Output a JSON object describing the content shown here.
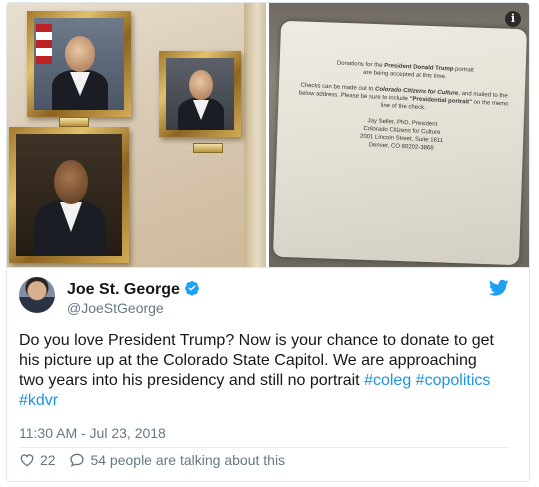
{
  "media": {
    "sign": {
      "para1_a": "Donations for the ",
      "para1_b": "President Donald Trump",
      "para1_c": " portrait",
      "para1_d": "are being accepted at this time.",
      "para2_a": "Checks can be made out to ",
      "para2_b": "Colorado Citizens for Culture",
      "para2_c": ", and mailed to the below address. Please be sure to include ",
      "para2_d": "\"Presidential portrait\"",
      "para2_e": " on the memo line of the check.",
      "addr1": "Jay Seller, PhD, President",
      "addr2": "Colorado Citizens for Culture",
      "addr3": "2001 Lincoln Street, Suite 1611",
      "addr4": "Denver, CO 80202-3868"
    },
    "info_icon_glyph": "i"
  },
  "author": {
    "name": "Joe St. George",
    "handle": "@JoeStGeorge",
    "verified_color": "#1da1f2"
  },
  "tweet": {
    "line1": "Do you love President Trump? Now is your chance to donate to get",
    "line2": "his picture up at the Colorado State Capitol. We are approaching",
    "line3_text": "two years into his presidency and still no portrait ",
    "hashtag1": "#coleg",
    "hashtag2": "#copolitics",
    "hashtag3": "#kdvr",
    "hashtag_color": "#1b95e0"
  },
  "timestamp": "11:30 AM - Jul 23, 2018",
  "actions": {
    "likes": "22",
    "talking": "54 people are talking about this"
  },
  "icons": {
    "bird": "twitter-bird-icon",
    "heart": "heart-icon",
    "reply": "comment-bubble-icon",
    "verified": "verified-badge-icon",
    "info": "info-icon"
  }
}
